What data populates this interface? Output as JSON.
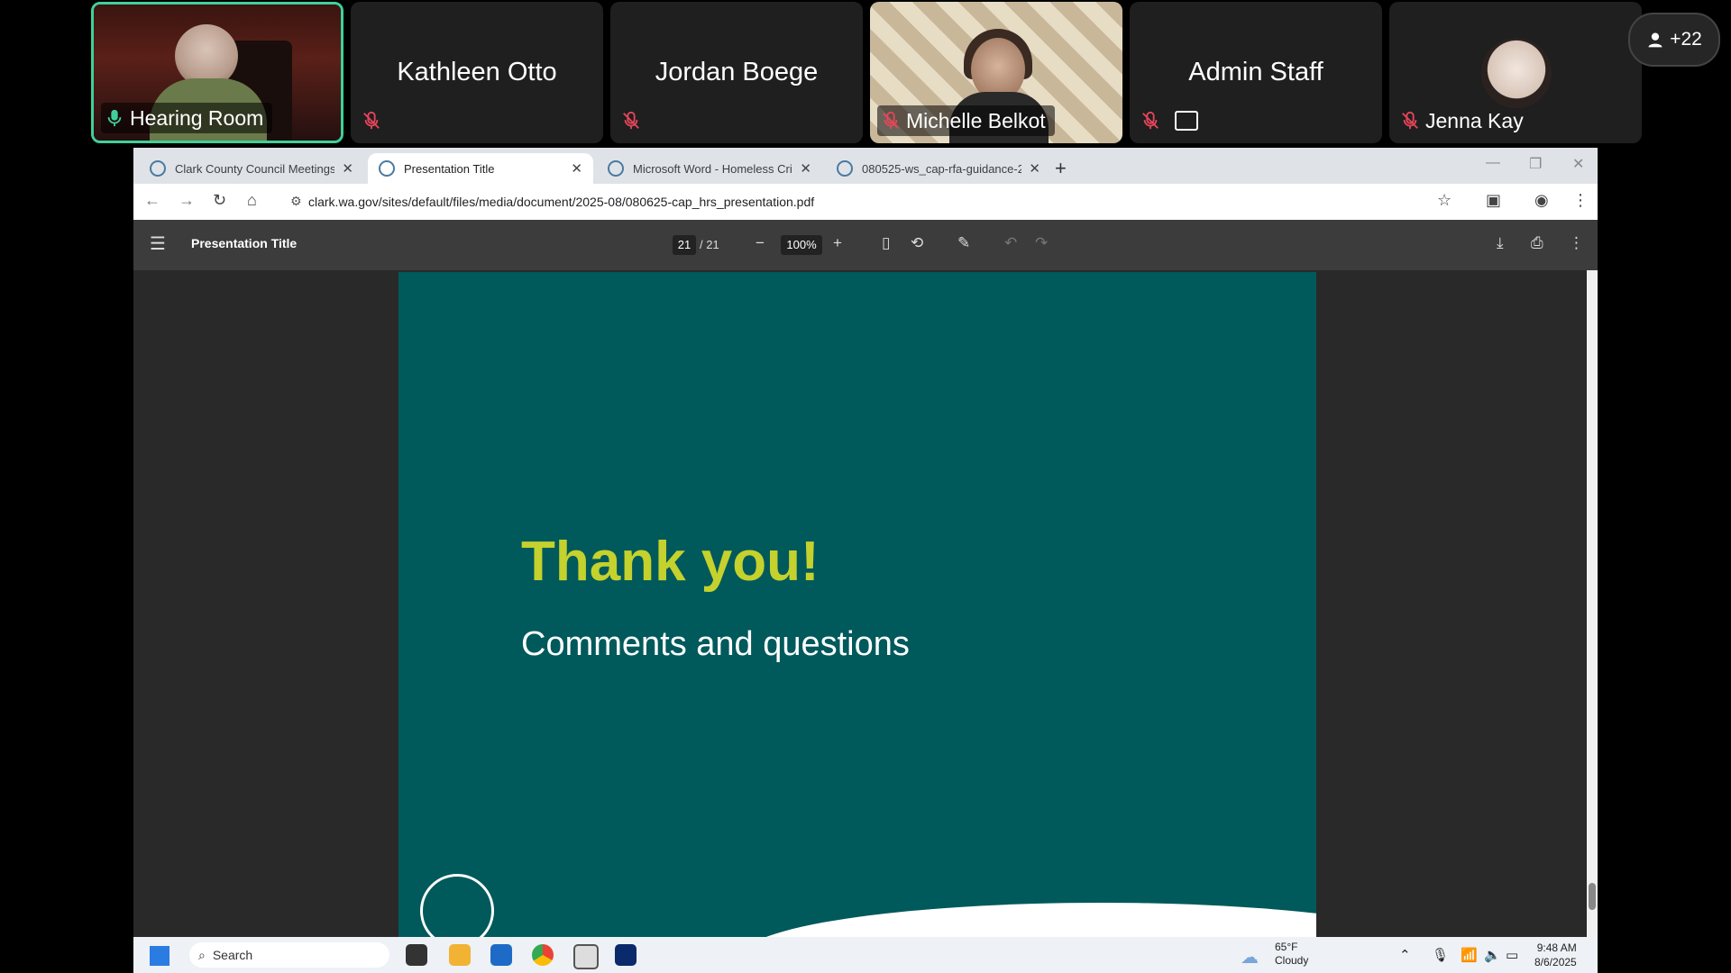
{
  "participants": {
    "tiles": [
      {
        "name": "Hearing Room"
      },
      {
        "name": "Kathleen Otto"
      },
      {
        "name": "Jordan Boege"
      },
      {
        "name": "Michelle Belkot"
      },
      {
        "name": "Admin Staff"
      },
      {
        "name": "Jenna Kay"
      }
    ],
    "more_count": "+22"
  },
  "browser": {
    "tabs": [
      {
        "title": "Clark County Council Meetings"
      },
      {
        "title": "Presentation Title"
      },
      {
        "title": "Microsoft Word - Homeless Cri"
      },
      {
        "title": "080525-ws_cap-rfa-guidance-2"
      }
    ],
    "url": "clark.wa.gov/sites/default/files/media/document/2025-08/080625-cap_hrs_presentation.pdf"
  },
  "pdf": {
    "title": "Presentation Title",
    "current_page": "21",
    "total_pages": "/ 21",
    "zoom": "100%"
  },
  "slide": {
    "heading": "Thank you!",
    "subheading": "Comments and questions",
    "heading_color": "#c5d12c",
    "background_color": "#00595b"
  },
  "taskbar": {
    "search_placeholder": "Search",
    "temperature": "65°F",
    "condition": "Cloudy",
    "time": "9:48 AM",
    "date": "8/6/2025"
  }
}
